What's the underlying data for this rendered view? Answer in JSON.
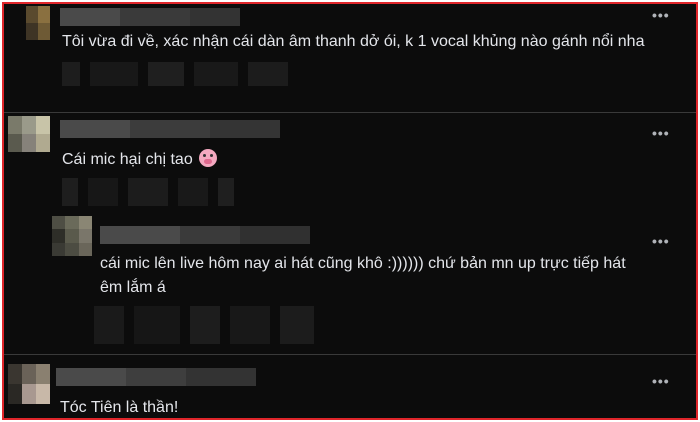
{
  "comments": [
    {
      "text": "Tôi vừa đi về, xác nhận cái dàn âm thanh dở ói, k 1 vocal khủng nào gánh nổi nha",
      "more_label": "•••"
    },
    {
      "text": "Cái mic hại chị tao",
      "emoji": "pig-face",
      "more_label": "•••"
    },
    {
      "text": "cái mic lên live hôm nay ai hát cũng khô :)))))) chứ bản mn up trực tiếp hát êm lắm á",
      "more_label": "•••"
    },
    {
      "text": "Tóc Tiên là thần!",
      "more_label": "•••"
    }
  ],
  "colors": {
    "frame_border": "#e0262b",
    "background": "#0c0c0c",
    "text": "#e4e6eb"
  }
}
